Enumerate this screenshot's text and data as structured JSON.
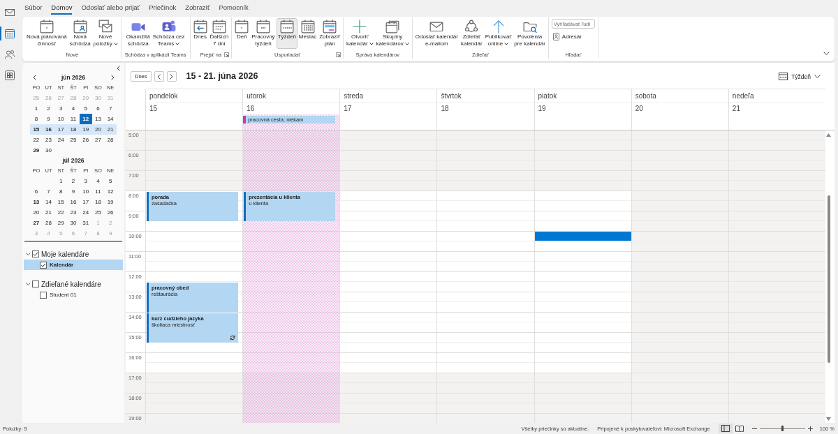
{
  "nav_bar": {
    "items": [
      {
        "selected": false
      },
      {
        "selected": true
      },
      {
        "selected": false
      },
      {
        "selected": false
      }
    ]
  },
  "ribbon": {
    "tabs": [
      {
        "label": "Súbor",
        "selected": false
      },
      {
        "label": "Domov",
        "selected": true
      },
      {
        "label": "Odoslať alebo prijať",
        "selected": false
      },
      {
        "label": "Priečinok",
        "selected": false
      },
      {
        "label": "Zobraziť",
        "selected": false
      },
      {
        "label": "Pomocník",
        "selected": false
      }
    ],
    "groups": [
      {
        "label": "Nové",
        "kind": "large",
        "launcher": false,
        "buttons": [
          {
            "label": "Nová plánovaná\nčinnosť",
            "dropdown": false
          },
          {
            "label": "Nová\nschôdza",
            "dropdown": false
          },
          {
            "label": "Nové\npoložky",
            "dropdown": true
          }
        ]
      },
      {
        "label": "Schôdza v aplikácii Teams",
        "kind": "large",
        "launcher": false,
        "buttons": [
          {
            "label": "Okamžitá\nschôdza",
            "dropdown": false
          },
          {
            "label": "Schôdza cez\nTeams",
            "dropdown": true
          }
        ]
      },
      {
        "label": "Prejsť na",
        "kind": "large",
        "launcher": true,
        "buttons": [
          {
            "label": "Dnes",
            "dropdown": false
          },
          {
            "label": "Ďalších\n7 dní",
            "dropdown": false
          }
        ]
      },
      {
        "label": "Usporiadať",
        "kind": "large",
        "launcher": true,
        "buttons": [
          {
            "label": "Deň",
            "dropdown": false,
            "selected": false
          },
          {
            "label": "Pracovný\ntýždeň",
            "dropdown": false,
            "selected": false
          },
          {
            "label": "Týždeň",
            "dropdown": false,
            "selected": true
          },
          {
            "label": "Mesiac",
            "dropdown": false,
            "selected": false
          },
          {
            "label": "Zobraziť\nplán",
            "dropdown": false,
            "selected": false
          }
        ]
      },
      {
        "label": "Správa kalendárov",
        "kind": "large",
        "launcher": false,
        "buttons": [
          {
            "label": "Otvoriť\nkalendár",
            "dropdown": true
          },
          {
            "label": "Skupiny\nkalendárov",
            "dropdown": true
          }
        ]
      },
      {
        "label": "Zdieľať",
        "kind": "large",
        "launcher": false,
        "buttons": [
          {
            "label": "Odoslať kalendár\ne-mailom",
            "dropdown": false
          },
          {
            "label": "Zdieľať\nkalendár",
            "dropdown": false
          },
          {
            "label": "Publikovať\nonline",
            "dropdown": true
          },
          {
            "label": "Povolenia\npre kalendár",
            "dropdown": false
          }
        ]
      },
      {
        "label": "Hľadať",
        "kind": "search",
        "launcher": false,
        "search": {
          "placeholder": "Vyhľadávať ľudí"
        },
        "buttons": [
          {
            "label": "Adresár",
            "dropdown": false
          }
        ]
      }
    ]
  },
  "mini_calendars": [
    {
      "title": "jún 2026",
      "weekdays": [
        "PO",
        "UT",
        "ST",
        "ŠT",
        "PI",
        "SO",
        "NE"
      ],
      "weeks": [
        {
          "selected": false,
          "days": [
            {
              "label": "25",
              "muted": true,
              "bold": false,
              "today": false
            },
            {
              "label": "26",
              "muted": true,
              "bold": false,
              "today": false
            },
            {
              "label": "27",
              "muted": true,
              "bold": false,
              "today": false
            },
            {
              "label": "28",
              "muted": true,
              "bold": false,
              "today": false
            },
            {
              "label": "29",
              "muted": true,
              "bold": false,
              "today": false
            },
            {
              "label": "30",
              "muted": true,
              "bold": false,
              "today": false
            },
            {
              "label": "31",
              "muted": true,
              "bold": false,
              "today": false
            }
          ]
        },
        {
          "selected": false,
          "days": [
            {
              "label": "1",
              "muted": false,
              "bold": false,
              "today": false
            },
            {
              "label": "2",
              "muted": false,
              "bold": false,
              "today": false
            },
            {
              "label": "3",
              "muted": false,
              "bold": false,
              "today": false
            },
            {
              "label": "4",
              "muted": false,
              "bold": false,
              "today": false
            },
            {
              "label": "5",
              "muted": false,
              "bold": false,
              "today": false
            },
            {
              "label": "6",
              "muted": false,
              "bold": false,
              "today": false
            },
            {
              "label": "7",
              "muted": false,
              "bold": false,
              "today": false
            }
          ]
        },
        {
          "selected": false,
          "days": [
            {
              "label": "8",
              "muted": false,
              "bold": false,
              "today": false
            },
            {
              "label": "9",
              "muted": false,
              "bold": false,
              "today": false
            },
            {
              "label": "10",
              "muted": false,
              "bold": false,
              "today": false
            },
            {
              "label": "11",
              "muted": false,
              "bold": false,
              "today": false
            },
            {
              "label": "12",
              "muted": false,
              "bold": false,
              "today": true
            },
            {
              "label": "13",
              "muted": false,
              "bold": false,
              "today": false
            },
            {
              "label": "14",
              "muted": false,
              "bold": false,
              "today": false
            }
          ]
        },
        {
          "selected": true,
          "days": [
            {
              "label": "15",
              "muted": false,
              "bold": true,
              "today": false
            },
            {
              "label": "16",
              "muted": false,
              "bold": true,
              "today": false
            },
            {
              "label": "17",
              "muted": false,
              "bold": false,
              "today": false
            },
            {
              "label": "18",
              "muted": false,
              "bold": false,
              "today": false
            },
            {
              "label": "19",
              "muted": false,
              "bold": false,
              "today": false
            },
            {
              "label": "20",
              "muted": false,
              "bold": false,
              "today": false
            },
            {
              "label": "21",
              "muted": false,
              "bold": false,
              "today": false
            }
          ]
        },
        {
          "selected": false,
          "days": [
            {
              "label": "22",
              "muted": false,
              "bold": false,
              "today": false
            },
            {
              "label": "23",
              "muted": false,
              "bold": false,
              "today": false
            },
            {
              "label": "24",
              "muted": false,
              "bold": false,
              "today": false
            },
            {
              "label": "25",
              "muted": false,
              "bold": false,
              "today": false
            },
            {
              "label": "26",
              "muted": false,
              "bold": false,
              "today": false
            },
            {
              "label": "27",
              "muted": false,
              "bold": false,
              "today": false
            },
            {
              "label": "28",
              "muted": false,
              "bold": false,
              "today": false
            }
          ]
        },
        {
          "selected": false,
          "days": [
            {
              "label": "29",
              "muted": false,
              "bold": true,
              "today": false
            },
            {
              "label": "30",
              "muted": false,
              "bold": false,
              "today": false
            }
          ]
        }
      ]
    },
    {
      "title": "júl 2026",
      "weekdays": [
        "PO",
        "UT",
        "ST",
        "ŠT",
        "PI",
        "SO",
        "NE"
      ],
      "weeks": [
        {
          "selected": false,
          "days": [
            {
              "label": "1",
              "muted": false,
              "bold": false,
              "today": false
            },
            {
              "label": "2",
              "muted": false,
              "bold": false,
              "today": false
            },
            {
              "label": "3",
              "muted": false,
              "bold": false,
              "today": false
            },
            {
              "label": "4",
              "muted": false,
              "bold": false,
              "today": false
            },
            {
              "label": "5",
              "muted": false,
              "bold": false,
              "today": false
            }
          ]
        },
        {
          "selected": false,
          "days": [
            {
              "label": "6",
              "muted": false,
              "bold": false,
              "today": false
            },
            {
              "label": "7",
              "muted": false,
              "bold": false,
              "today": false
            },
            {
              "label": "8",
              "muted": false,
              "bold": false,
              "today": false
            },
            {
              "label": "9",
              "muted": false,
              "bold": false,
              "today": false
            },
            {
              "label": "10",
              "muted": false,
              "bold": false,
              "today": false
            },
            {
              "label": "11",
              "muted": false,
              "bold": false,
              "today": false
            },
            {
              "label": "12",
              "muted": false,
              "bold": false,
              "today": false
            }
          ]
        },
        {
          "selected": false,
          "days": [
            {
              "label": "13",
              "muted": false,
              "bold": true,
              "today": false
            },
            {
              "label": "14",
              "muted": false,
              "bold": false,
              "today": false
            },
            {
              "label": "15",
              "muted": false,
              "bold": false,
              "today": false
            },
            {
              "label": "16",
              "muted": false,
              "bold": false,
              "today": false
            },
            {
              "label": "17",
              "muted": false,
              "bold": false,
              "today": false
            },
            {
              "label": "18",
              "muted": false,
              "bold": false,
              "today": false
            },
            {
              "label": "19",
              "muted": false,
              "bold": false,
              "today": false
            }
          ]
        },
        {
          "selected": false,
          "days": [
            {
              "label": "20",
              "muted": false,
              "bold": false,
              "today": false
            },
            {
              "label": "21",
              "muted": false,
              "bold": false,
              "today": false
            },
            {
              "label": "22",
              "muted": false,
              "bold": false,
              "today": false
            },
            {
              "label": "23",
              "muted": false,
              "bold": false,
              "today": false
            },
            {
              "label": "24",
              "muted": false,
              "bold": false,
              "today": false
            },
            {
              "label": "25",
              "muted": false,
              "bold": false,
              "today": false
            },
            {
              "label": "26",
              "muted": false,
              "bold": false,
              "today": false
            }
          ]
        },
        {
          "selected": false,
          "days": [
            {
              "label": "27",
              "muted": false,
              "bold": true,
              "today": false
            },
            {
              "label": "28",
              "muted": false,
              "bold": false,
              "today": false
            },
            {
              "label": "29",
              "muted": false,
              "bold": false,
              "today": false
            },
            {
              "label": "30",
              "muted": false,
              "bold": false,
              "today": false
            },
            {
              "label": "31",
              "muted": false,
              "bold": false,
              "today": false
            },
            {
              "label": "1",
              "muted": true,
              "bold": false,
              "today": false
            },
            {
              "label": "2",
              "muted": true,
              "bold": false,
              "today": false
            }
          ]
        },
        {
          "selected": false,
          "days": [
            {
              "label": "3",
              "muted": true,
              "bold": false,
              "today": false
            },
            {
              "label": "4",
              "muted": true,
              "bold": false,
              "today": false
            },
            {
              "label": "5",
              "muted": true,
              "bold": false,
              "today": false
            },
            {
              "label": "6",
              "muted": true,
              "bold": false,
              "today": false
            },
            {
              "label": "7",
              "muted": true,
              "bold": false,
              "today": false
            },
            {
              "label": "8",
              "muted": true,
              "bold": false,
              "today": false
            },
            {
              "label": "9",
              "muted": true,
              "bold": false,
              "today": false
            }
          ]
        }
      ]
    }
  ],
  "calendar_folders": [
    {
      "label": "Moje kalendáre",
      "checked": true,
      "expanded": true,
      "children": [
        {
          "label": "Kalendár",
          "checked": true,
          "selected": true
        }
      ]
    },
    {
      "label": "Zdieľané kalendáre",
      "checked": false,
      "expanded": true,
      "children": [
        {
          "label": "Student 01",
          "checked": false,
          "selected": false
        }
      ]
    }
  ],
  "calendar": {
    "today_button": "Dnes",
    "title": "15 - 21. júna 2026",
    "view_switcher": "Týždeň",
    "hours": [
      {
        "label": "5:00",
        "working": false
      },
      {
        "label": "6:00",
        "working": false
      },
      {
        "label": "7:00",
        "working": false
      },
      {
        "label": "8:00",
        "working": true
      },
      {
        "label": "9:00",
        "working": true
      },
      {
        "label": "10:00",
        "working": true
      },
      {
        "label": "11:00",
        "working": true
      },
      {
        "label": "12:00",
        "working": true
      },
      {
        "label": "13:00",
        "working": true
      },
      {
        "label": "14:00",
        "working": true
      },
      {
        "label": "15:00",
        "working": true
      },
      {
        "label": "16:00",
        "working": true
      },
      {
        "label": "17:00",
        "working": false
      },
      {
        "label": "18:00",
        "working": false
      },
      {
        "label": "19:00",
        "working": false
      }
    ],
    "days": [
      {
        "name": "pondelok",
        "date": "15",
        "workday": true,
        "slots": [
          {
            "busy": false,
            "selected": false
          },
          {
            "busy": false,
            "selected": false
          },
          {
            "busy": false,
            "selected": false
          },
          {
            "busy": false,
            "selected": false
          },
          {
            "busy": false,
            "selected": false
          },
          {
            "busy": false,
            "selected": false
          },
          {
            "busy": true,
            "selected": false,
            "event": {
              "title": "porada",
              "location": "zasadačka",
              "recurring": false
            }
          },
          {
            "busy": true,
            "selected": false
          },
          {
            "busy": true,
            "selected": false
          },
          {
            "busy": false,
            "selected": false
          },
          {
            "busy": false,
            "selected": false
          },
          {
            "busy": false,
            "selected": false
          },
          {
            "busy": false,
            "selected": false
          },
          {
            "busy": false,
            "selected": false
          },
          {
            "busy": false,
            "selected": false
          },
          {
            "busy": true,
            "selected": false,
            "event": {
              "title": "pracovný obed",
              "location": "reštaurácia",
              "recurring": false
            }
          },
          {
            "busy": true,
            "selected": false
          },
          {
            "busy": true,
            "selected": false
          },
          {
            "busy": true,
            "selected": false,
            "event": {
              "title": "kurz cudzieho jazyka",
              "location": "školiaca miestnosť",
              "recurring": true
            }
          },
          {
            "busy": true,
            "selected": false
          },
          {
            "busy": true,
            "selected": false
          },
          {
            "busy": false,
            "selected": false
          },
          {
            "busy": false,
            "selected": false
          },
          {
            "busy": false,
            "selected": false
          },
          {
            "busy": false,
            "selected": false
          },
          {
            "busy": false,
            "selected": false
          },
          {
            "busy": false,
            "selected": false
          },
          {
            "busy": false,
            "selected": false
          },
          {
            "busy": false,
            "selected": false
          }
        ]
      },
      {
        "name": "utorok",
        "date": "16",
        "workday": true,
        "all_day": [
          {
            "title": "pracovná cesta; niekam",
            "out_of_office": true
          }
        ],
        "slots": [
          {
            "busy": false,
            "selected": false
          },
          {
            "busy": false,
            "selected": false
          },
          {
            "busy": false,
            "selected": false
          },
          {
            "busy": false,
            "selected": false
          },
          {
            "busy": false,
            "selected": false
          },
          {
            "busy": false,
            "selected": false
          },
          {
            "busy": true,
            "selected": false,
            "event": {
              "title": "prezentácia u klienta",
              "location": "u klienta",
              "recurring": false
            }
          },
          {
            "busy": true,
            "selected": false
          },
          {
            "busy": true,
            "selected": false
          },
          {
            "busy": false,
            "selected": false
          },
          {
            "busy": false,
            "selected": false
          },
          {
            "busy": false,
            "selected": false
          },
          {
            "busy": false,
            "selected": false
          },
          {
            "busy": false,
            "selected": false
          },
          {
            "busy": false,
            "selected": false
          },
          {
            "busy": false,
            "selected": false
          },
          {
            "busy": false,
            "selected": false
          },
          {
            "busy": false,
            "selected": false
          },
          {
            "busy": false,
            "selected": false
          },
          {
            "busy": false,
            "selected": false
          },
          {
            "busy": false,
            "selected": false
          },
          {
            "busy": false,
            "selected": false
          },
          {
            "busy": false,
            "selected": false
          },
          {
            "busy": false,
            "selected": false
          },
          {
            "busy": false,
            "selected": false
          },
          {
            "busy": false,
            "selected": false
          },
          {
            "busy": false,
            "selected": false
          },
          {
            "busy": false,
            "selected": false
          },
          {
            "busy": false,
            "selected": false
          }
        ]
      },
      {
        "name": "streda",
        "date": "17",
        "workday": true
      },
      {
        "name": "štvrtok",
        "date": "18",
        "workday": true
      },
      {
        "name": "piatok",
        "date": "19",
        "workday": true,
        "slots": [
          {
            "busy": false,
            "selected": false
          },
          {
            "busy": false,
            "selected": false
          },
          {
            "busy": false,
            "selected": false
          },
          {
            "busy": false,
            "selected": false
          },
          {
            "busy": false,
            "selected": false
          },
          {
            "busy": false,
            "selected": false
          },
          {
            "busy": false,
            "selected": false
          },
          {
            "busy": false,
            "selected": false
          },
          {
            "busy": false,
            "selected": false
          },
          {
            "busy": false,
            "selected": false
          },
          {
            "busy": false,
            "selected": true
          },
          {
            "busy": false,
            "selected": false
          },
          {
            "busy": false,
            "selected": false
          },
          {
            "busy": false,
            "selected": false
          },
          {
            "busy": false,
            "selected": false
          },
          {
            "busy": false,
            "selected": false
          },
          {
            "busy": false,
            "selected": false
          },
          {
            "busy": false,
            "selected": false
          },
          {
            "busy": false,
            "selected": false
          },
          {
            "busy": false,
            "selected": false
          },
          {
            "busy": false,
            "selected": false
          },
          {
            "busy": false,
            "selected": false
          },
          {
            "busy": false,
            "selected": false
          },
          {
            "busy": false,
            "selected": false
          },
          {
            "busy": false,
            "selected": false
          },
          {
            "busy": false,
            "selected": false
          },
          {
            "busy": false,
            "selected": false
          },
          {
            "busy": false,
            "selected": false
          },
          {
            "busy": false,
            "selected": false
          }
        ]
      },
      {
        "name": "sobota",
        "date": "20",
        "workday": false
      },
      {
        "name": "nedeľa",
        "date": "21",
        "workday": false
      }
    ]
  },
  "status_bar": {
    "item_count": "Položky: 5",
    "sync_status": "Všetky priečinky sú aktuálne.",
    "connection": "Pripojené k poskytovateľovi: Microsoft Exchange",
    "views": [
      {
        "selected": true
      },
      {
        "selected": false
      }
    ],
    "zoom": {
      "level": 0.5,
      "reading": "100 %"
    }
  }
}
